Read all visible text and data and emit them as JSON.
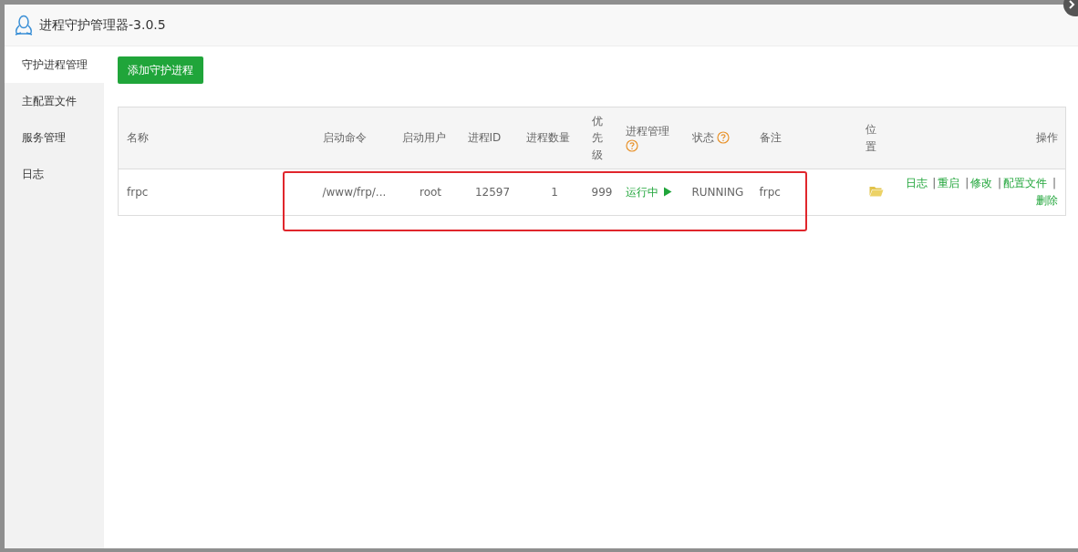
{
  "window": {
    "title": "进程守护管理器-3.0.5"
  },
  "sidebar": {
    "items": [
      {
        "label": "守护进程管理",
        "selected": true
      },
      {
        "label": "主配置文件",
        "selected": false
      },
      {
        "label": "服务管理",
        "selected": false
      },
      {
        "label": "日志",
        "selected": false
      }
    ]
  },
  "add_button": "添加守护进程",
  "table": {
    "columns": [
      {
        "label": "名称"
      },
      {
        "label": "启动命令"
      },
      {
        "label": "启动用户"
      },
      {
        "label": "进程ID"
      },
      {
        "label": "进程数量"
      },
      {
        "label": "优先级"
      },
      {
        "label": "进程管理",
        "help": true
      },
      {
        "label": "状态",
        "help": true
      },
      {
        "label": "备注"
      },
      {
        "label": "位置"
      },
      {
        "label": "操作"
      }
    ],
    "rows": [
      {
        "name": "frpc",
        "command": "/www/frp/...",
        "user": "root",
        "pid": "12597",
        "count": "1",
        "priority": "999",
        "management": "运行中",
        "running": true,
        "status": "RUNNING",
        "note": "frpc",
        "actions": [
          "日志",
          "重启",
          "修改",
          "配置文件",
          "删除"
        ]
      }
    ],
    "action_separator": "|"
  }
}
